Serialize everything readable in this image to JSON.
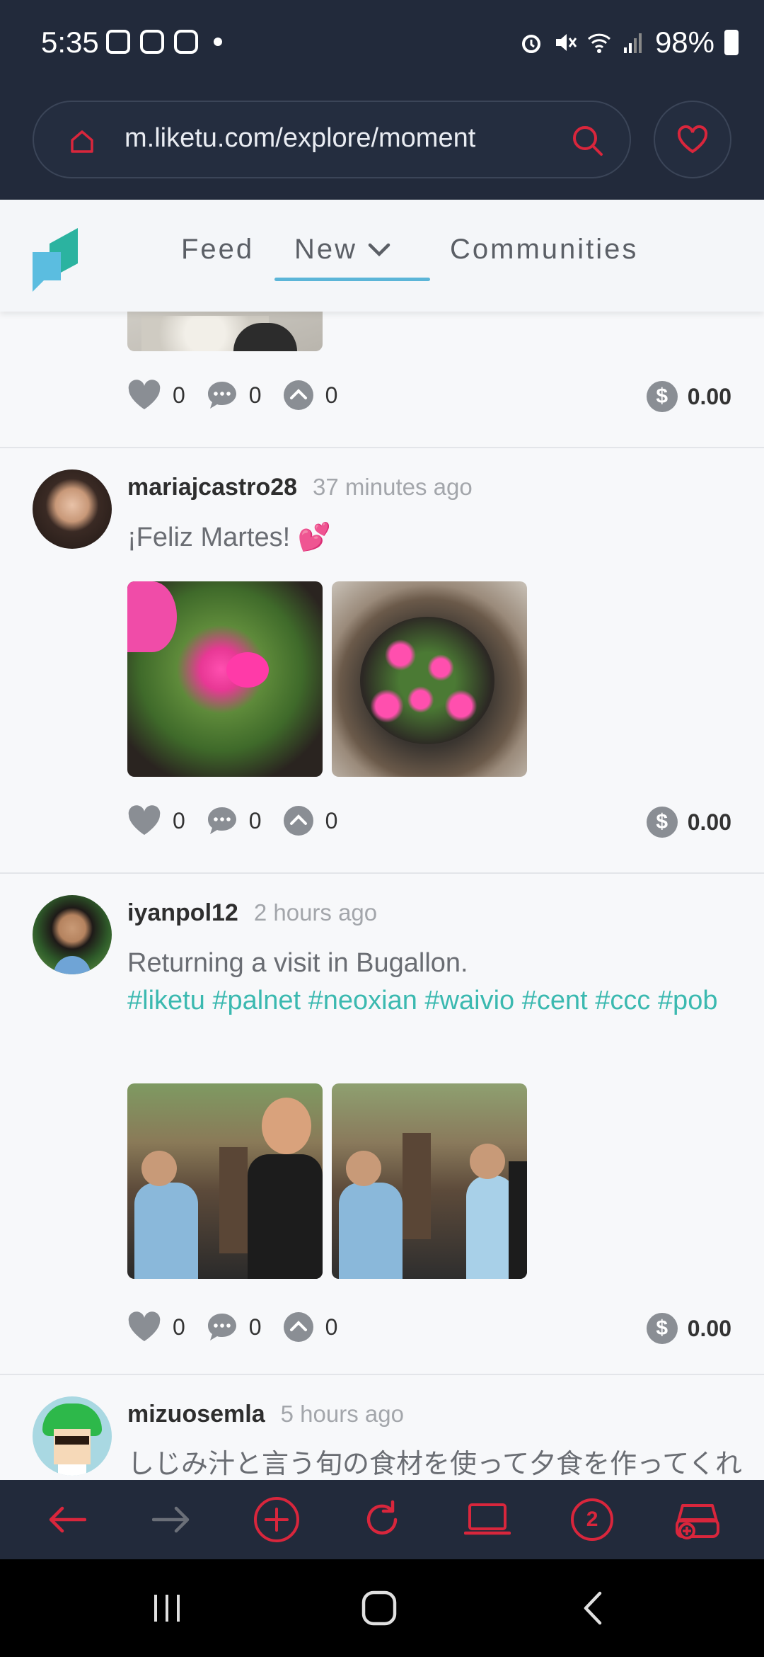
{
  "status_bar": {
    "time": "5:35",
    "battery": "98%"
  },
  "browser": {
    "url": "m.liketu.com/explore/moment",
    "tab_count": "2"
  },
  "nav": {
    "feed": "Feed",
    "new": "New",
    "communities": "Communities"
  },
  "posts": [
    {
      "likes": "0",
      "comments": "0",
      "votes": "0",
      "payout": "0.00"
    },
    {
      "username": "mariajcastro28",
      "time": "37 minutes ago",
      "text": "¡Feliz Martes! 💕",
      "likes": "0",
      "comments": "0",
      "votes": "0",
      "payout": "0.00"
    },
    {
      "username": "iyanpol12",
      "time": "2 hours ago",
      "text": "Returning a visit in Bugallon.",
      "tags": "#liketu #palnet #neoxian #waivio #cent #ccc #pob",
      "likes": "0",
      "comments": "0",
      "votes": "0",
      "payout": "0.00"
    },
    {
      "username": "mizuosemla",
      "time": "5 hours ago",
      "text": "しじみ汁と言う旬の食材を使って夕食を作ってくれ"
    }
  ],
  "colors": {
    "accent": "#d9263c",
    "teal": "#3bb9b0",
    "dark_bg": "#222a3b"
  },
  "icons": [
    "home-icon",
    "search-icon",
    "heart-icon",
    "back-icon",
    "forward-icon",
    "add-icon",
    "reload-icon",
    "desktop-icon",
    "tabs-icon",
    "incognito-icon"
  ]
}
